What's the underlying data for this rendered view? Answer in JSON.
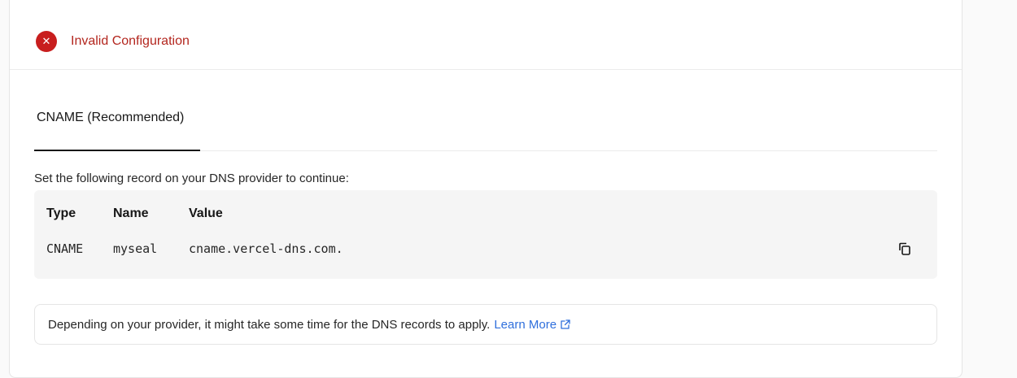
{
  "status": {
    "icon": "close-icon",
    "text": "Invalid Configuration",
    "color": "#c81e1e"
  },
  "tabs": [
    {
      "label": "CNAME (Recommended)",
      "active": true
    }
  ],
  "instruction": "Set the following record on your DNS provider to continue:",
  "record_table": {
    "headers": [
      "Type",
      "Name",
      "Value"
    ],
    "row": [
      "CNAME",
      "myseal",
      "cname.vercel-dns.com."
    ],
    "copy_icon": "copy-icon"
  },
  "note": {
    "text": "Depending on your provider, it might take some time for the DNS records to apply.",
    "link_label": "Learn More",
    "link_icon": "external-link-icon",
    "link_color": "#2f6fdc"
  }
}
